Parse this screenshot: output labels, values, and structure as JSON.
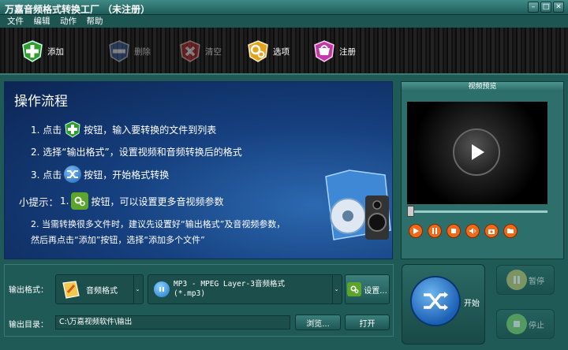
{
  "window": {
    "title": "万嘉音频格式转换工厂  （未注册）"
  },
  "menu": [
    "文件",
    "编辑",
    "动作",
    "帮助"
  ],
  "toolbar": [
    {
      "label": "添加",
      "icon": "plus-icon",
      "enabled": true
    },
    {
      "label": "删除",
      "icon": "shield-delete-icon",
      "enabled": false
    },
    {
      "label": "清空",
      "icon": "x-clear-icon",
      "enabled": false
    },
    {
      "label": "选项",
      "icon": "gears-icon",
      "enabled": true
    },
    {
      "label": "注册",
      "icon": "cart-icon",
      "enabled": true
    }
  ],
  "flow": {
    "heading": "操作流程",
    "step1_pre": "1. 点击",
    "step1_post": "按钮，输入要转换的文件到列表",
    "step2": "2. 选择“输出格式”，设置视频和音频转换后的格式",
    "step3_pre": "3. 点击",
    "step3_post": "按钮，开始格式转换",
    "tip_label": "小提示：",
    "tip1_pre": "1.",
    "tip1_post": "按钮，可以设置更多音视频参数",
    "tip2_line1": "2. 当需转换很多文件时，建议先设置好“输出格式”及音视频参数，",
    "tip2_line2": "然后再点击“添加”按钮，选择“添加多个文件”"
  },
  "preview": {
    "title": "视频预览",
    "seek_percent": 0
  },
  "output": {
    "format_label": "输出格式：",
    "category": "音频格式",
    "format": "MP3 - MPEG Layer-3音频格式",
    "format_ext": "(*.mp3)",
    "settings": "设置...",
    "dir_label": "输出目录：",
    "dir_value": "C:\\万嘉视频软件\\输出",
    "browse": "浏览...",
    "open": "打开"
  },
  "actions": {
    "start": "开始",
    "pause": "暂停",
    "stop": "停止"
  },
  "colors": {
    "accent": "#1f5a57",
    "orange": "#ee6a1a",
    "blue": "#16407f"
  }
}
